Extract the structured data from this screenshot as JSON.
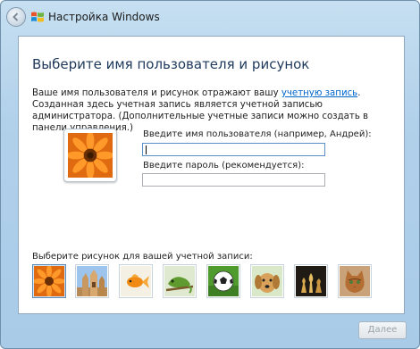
{
  "window": {
    "title": "Настройка Windows"
  },
  "main": {
    "heading": "Выберите имя пользователя и рисунок",
    "desc_before": "Ваше имя пользователя и рисунок отражают вашу ",
    "desc_link": "учетную запись",
    "desc_after": ". Созданная здесь учетная запись является учетной записью администратора. (Дополнительные учетные записи можно создать в панели управления.)",
    "username_label": "Введите имя пользователя (например, Андрей):",
    "username_value": "",
    "password_label": "Введите пароль (рекомендуется):",
    "password_value": "",
    "pictures_label": "Выберите рисунок для вашей учетной записи:",
    "pictures": [
      {
        "name": "orange-flower",
        "selected": true
      },
      {
        "name": "temple-ruins",
        "selected": false
      },
      {
        "name": "goldfish",
        "selected": false
      },
      {
        "name": "chameleon",
        "selected": false
      },
      {
        "name": "soccer-ball",
        "selected": false
      },
      {
        "name": "puppy",
        "selected": false
      },
      {
        "name": "chess-pieces",
        "selected": false
      },
      {
        "name": "kitten",
        "selected": false
      }
    ]
  },
  "footer": {
    "next_label": "Далее"
  },
  "colors": {
    "heading": "#1e395b",
    "link": "#0066cc",
    "chrome": "#b1d0ea"
  }
}
